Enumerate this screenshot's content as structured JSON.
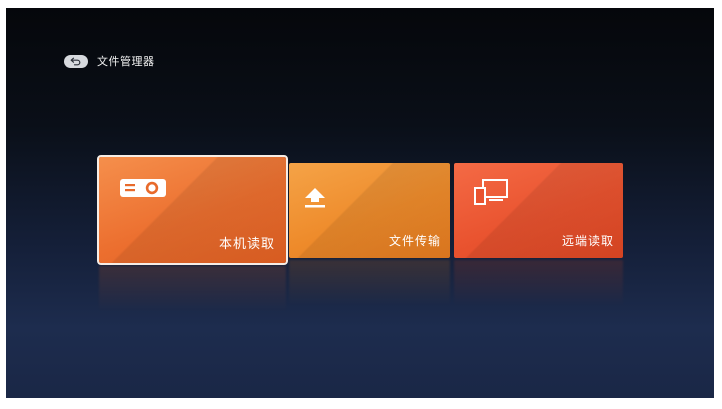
{
  "header": {
    "back_icon": "back-arrow-icon",
    "title": "文件管理器"
  },
  "tiles": [
    {
      "label": "本机读取",
      "icon": "projector-icon",
      "color": "#ec6f2f",
      "focused": true
    },
    {
      "label": "文件传输",
      "icon": "upload-icon",
      "color": "#ee8b2b",
      "focused": false
    },
    {
      "label": "远端读取",
      "icon": "multi-device-icon",
      "color": "#e9532f",
      "focused": false
    }
  ],
  "colors": {
    "background_top": "#05070b",
    "background_bottom": "#1d2c4e",
    "focus_border": "#f6ede6"
  }
}
